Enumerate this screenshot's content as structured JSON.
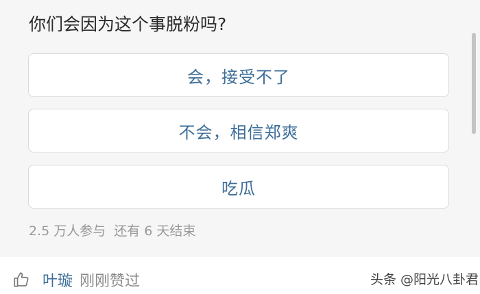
{
  "poll": {
    "question": "你们会因为这个事脱粉吗?",
    "options": [
      {
        "label": "会，接受不了"
      },
      {
        "label": "不会，相信郑爽"
      },
      {
        "label": "吃瓜"
      }
    ],
    "participants": "2.5 万人参与",
    "ends_in": "还有 6 天结束"
  },
  "like_bar": {
    "icon": "thumbs-up-icon",
    "user": "叶璇",
    "action": "刚刚赞过"
  },
  "watermark": "头条 @阳光八卦君",
  "colors": {
    "link_blue": "#3e6e99",
    "card_bg": "#f6f6f6",
    "muted_text": "#999999"
  }
}
